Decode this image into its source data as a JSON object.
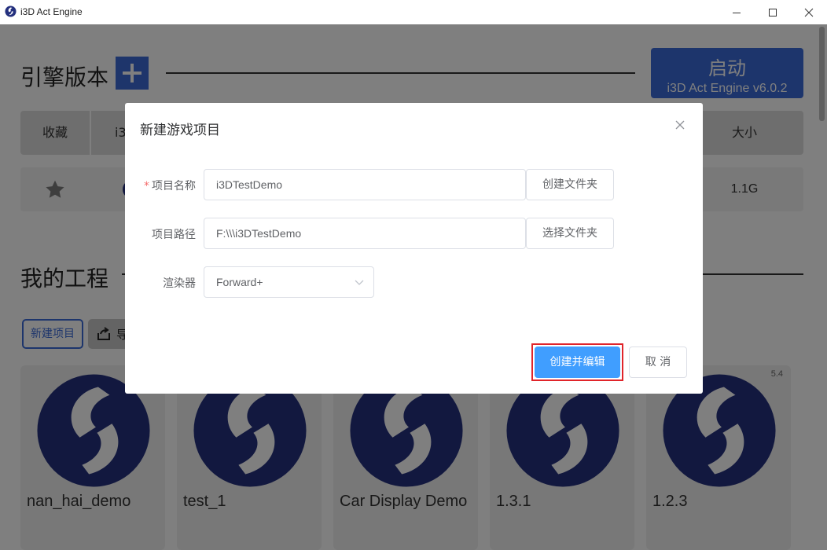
{
  "window": {
    "title": "i3D Act Engine"
  },
  "engine_section": {
    "title": "引擎版本",
    "launch_button": {
      "label": "启动",
      "version": "i3D Act Engine v6.0.2"
    },
    "table": {
      "headers": [
        "收藏",
        "i3",
        "大小"
      ],
      "row": {
        "favorite_icon": "star-icon",
        "size": "1.1G"
      }
    }
  },
  "projects_section": {
    "title": "我的工程",
    "new_project_button": "新建项目",
    "import_button": "导",
    "cards": [
      {
        "name": "nan_hai_demo",
        "version": ""
      },
      {
        "name": "test_1",
        "version": ""
      },
      {
        "name": "Car Display Demo",
        "version": ""
      },
      {
        "name": "1.3.1",
        "version": ""
      },
      {
        "name": "1.2.3",
        "version": "5.4"
      }
    ]
  },
  "dialog": {
    "title": "新建游戏项目",
    "fields": {
      "name": {
        "label": "项目名称",
        "required": "*",
        "value": "i3DTestDemo",
        "action": "创建文件夹"
      },
      "path": {
        "label": "项目路径",
        "value": "F:\\\\\\i3DTestDemo",
        "action": "选择文件夹"
      },
      "renderer": {
        "label": "渲染器",
        "value": "Forward+"
      }
    },
    "confirm_button": "创建并编辑",
    "cancel_button": "取 消"
  },
  "colors": {
    "accent_blue": "#3b6ad8",
    "primary_button": "#409eff",
    "highlight": "#e0242a",
    "logo_navy": "#24307e"
  }
}
